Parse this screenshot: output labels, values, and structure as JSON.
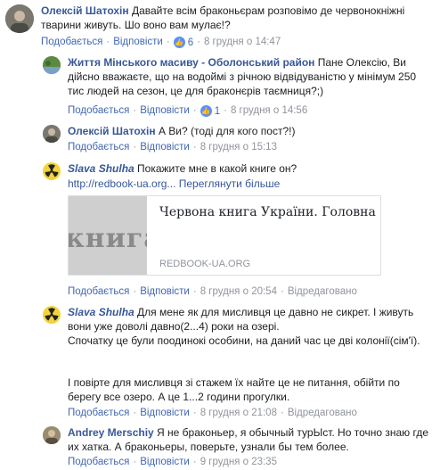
{
  "comments": [
    {
      "author": "Олексій Шатохін",
      "text": "Давайте всім браконьєрам розповімо де червонокніжні тварини живуть. Шо воно вам мулає!?",
      "like": "Подобається",
      "reply": "Відповісти",
      "reactions": "6",
      "time": "8 грудня о 14:47"
    },
    {
      "author": "Життя Мінського масиву - Оболонський район",
      "text": "Пане Олексію, Ви дійсно вважаєте, що на водоймі з річною відвідуваністю у мінімум 250 тис людей на сезон, це для браконєрів таємниця?;)",
      "like": "Подобається",
      "reply": "Відповісти",
      "reactions": "1",
      "time": "8 грудня о 14:56"
    },
    {
      "author": "Олексій Шатохін",
      "text": "А Ви? (тоді для кого пост?!)",
      "like": "Подобається",
      "reply": "Відповісти",
      "time": "8 грудня о 15:13"
    },
    {
      "author": "Slava Shulha",
      "text": "Покажите мне в какой книге он?",
      "link": "http://redbook-ua.org...",
      "see_more": "Переглянути більше",
      "preview": {
        "title": "Червона книга України. Головна",
        "domain": "REDBOOK-UA.ORG",
        "image_word": "книга"
      },
      "like": "Подобається",
      "reply": "Відповісти",
      "time": "8 грудня о 20:54",
      "edited": "Відредаговано"
    },
    {
      "author": "Slava Shulha",
      "text1": "Для мене як для мисливця це давно не сикрет. І живуть вони уже доволі давно(2...4) роки на озері.",
      "text2": "Спочатку це були поодинокі особини, на даний час це дві колонії(сім'ї).",
      "text3": "І повірте для мисливця зі стажем їх найте це не питання, обійти по берегу все озеро. А це 1...2 години прогулки.",
      "like": "Подобається",
      "reply": "Відповісти",
      "time": "8 грудня о 21:08",
      "edited": "Відредаговано"
    },
    {
      "author": "Andrey Merschiy",
      "text": "Я не браконьер, я обычный турЫст. Но точно знаю где их хатка. А браконьеры, поверьте, узнали бы тем более.",
      "like": "Подобається",
      "reply": "Відповісти",
      "time": "9 грудня о 23:35"
    }
  ],
  "icons": {
    "like": "thumbs-up-icon",
    "radiation": "radiation-icon"
  },
  "colors": {
    "link": "#385898",
    "meta": "#90949c",
    "like_bubble": "#5890ff"
  }
}
